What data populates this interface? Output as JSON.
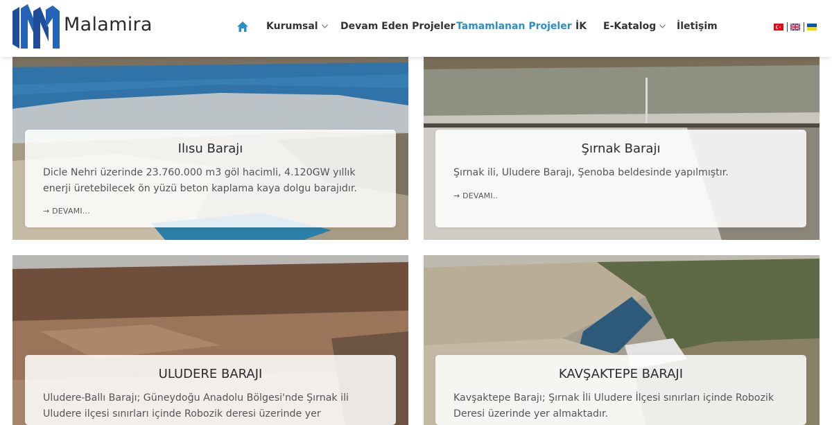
{
  "brand": {
    "name": "Malamira",
    "logo_icon": "malamira-logo",
    "logo_color": "#1f4d9a"
  },
  "nav": {
    "home_icon": "home-icon",
    "items": [
      {
        "label": "Kurumsal",
        "has_dropdown": true
      },
      {
        "label": "Devam Eden Projeler",
        "has_dropdown": false
      },
      {
        "label": "Tamamlanan Projeler",
        "has_dropdown": false,
        "active": true
      },
      {
        "label": "İK",
        "has_dropdown": false
      },
      {
        "label": "E-Katalog",
        "has_dropdown": true
      },
      {
        "label": "İletişim",
        "has_dropdown": false
      }
    ],
    "active_color": "#2a8fc7",
    "languages": [
      "turkey-flag-icon",
      "uk-flag-icon",
      "ukraine-flag-icon"
    ]
  },
  "projects": [
    {
      "title": "Ilısu Barajı",
      "description": "Dicle Nehri üzerinde 23.760.000 m3 göl hacimli, 4.120GW yıllık enerji üretebilecek ön yüzü beton kaplama kaya dolgu barajıdır.",
      "read_more": "→ DEVAMI..."
    },
    {
      "title": "Şırnak Barajı",
      "description": "Şırnak ili, Uludere Barajı, Şenoba beldesinde yapılmıştır.",
      "read_more": "→ DEVAMI.."
    },
    {
      "title": "ULUDERE BARAJI",
      "description": "Uludere-Ballı Barajı; Güneydoğu Anadolu Bölgesi'nde Şırnak ili Uludere ilçesi sınırları içinde Robozik deresi üzerinde yer almaktadır."
    },
    {
      "title": "KAVŞAKTEPE BARAJI",
      "description": "Kavşaktepe Barajı; Şırnak İli Uludere İlçesi sınırları içinde Robozik Deresi üzerinde yer almaktadır."
    }
  ]
}
